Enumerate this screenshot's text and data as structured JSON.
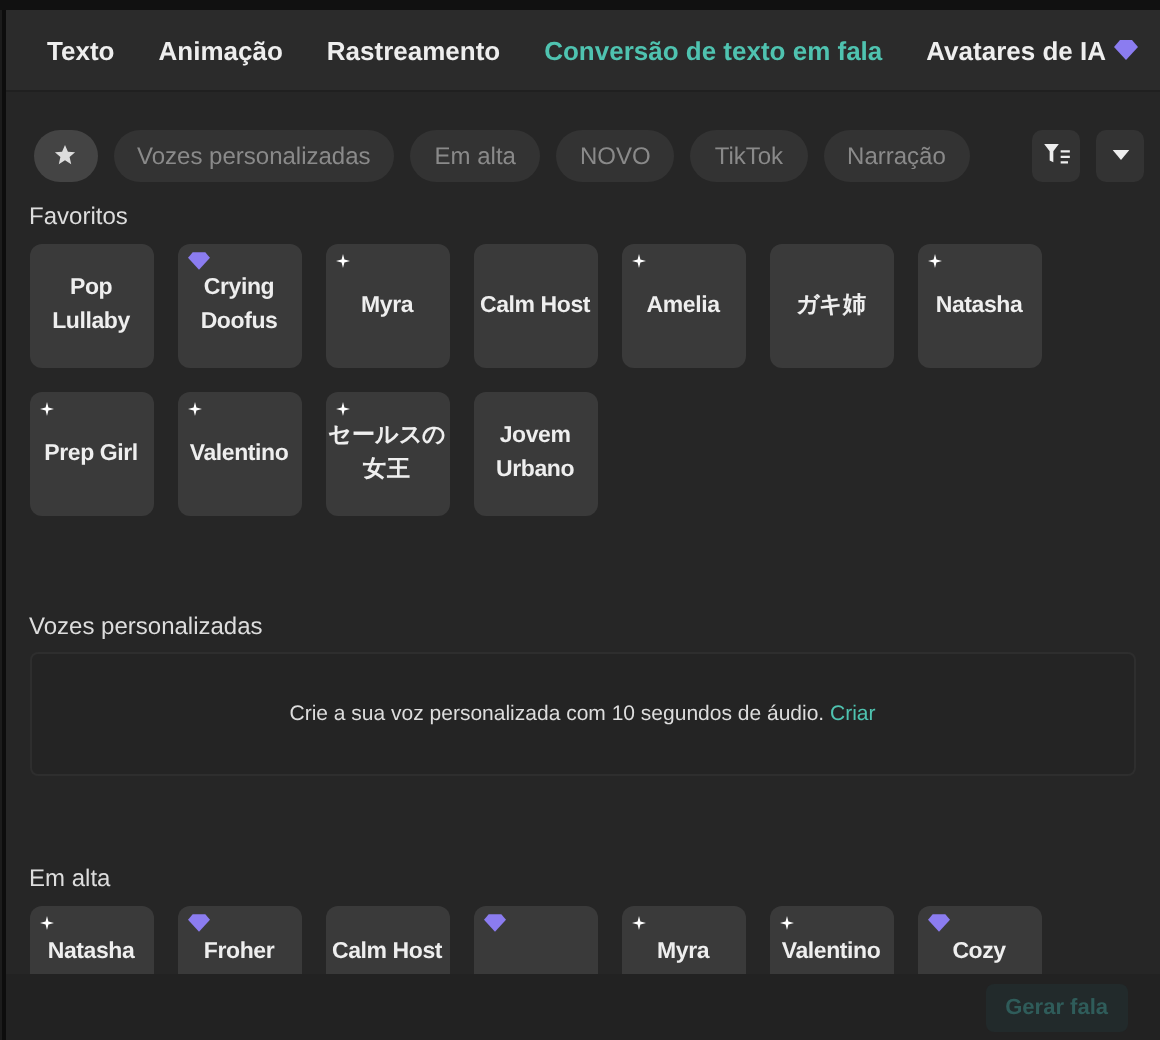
{
  "tabs": [
    {
      "label": "Texto",
      "selected": false,
      "premium": false
    },
    {
      "label": "Animação",
      "selected": false,
      "premium": false
    },
    {
      "label": "Rastreamento",
      "selected": false,
      "premium": false
    },
    {
      "label": "Conversão de texto em fala",
      "selected": true,
      "premium": false
    },
    {
      "label": "Avatares de IA",
      "selected": false,
      "premium": true
    }
  ],
  "filters": [
    {
      "kind": "star",
      "selected": true
    },
    {
      "kind": "text",
      "label": "Vozes personalizadas",
      "selected": false
    },
    {
      "kind": "text",
      "label": "Em alta",
      "selected": false
    },
    {
      "kind": "text",
      "label": "NOVO",
      "selected": false
    },
    {
      "kind": "text",
      "label": "TikTok",
      "selected": false
    },
    {
      "kind": "text",
      "label": "Narração",
      "selected": false
    }
  ],
  "favorites": {
    "title": "Favoritos",
    "voices": [
      {
        "name": "Pop Lullaby",
        "new": false,
        "premium": false
      },
      {
        "name": "Crying Doofus",
        "new": false,
        "premium": true
      },
      {
        "name": "Myra",
        "new": true,
        "premium": false
      },
      {
        "name": "Calm Host",
        "new": false,
        "premium": false
      },
      {
        "name": "Amelia",
        "new": true,
        "premium": false
      },
      {
        "name": "ガキ姉",
        "new": false,
        "premium": false
      },
      {
        "name": "Natasha",
        "new": true,
        "premium": false
      },
      {
        "name": "Prep Girl",
        "new": true,
        "premium": false
      },
      {
        "name": "Valentino",
        "new": true,
        "premium": false
      },
      {
        "name": "セールスの女王",
        "new": true,
        "premium": false
      },
      {
        "name": "Jovem Urbano",
        "new": false,
        "premium": false
      }
    ]
  },
  "custom": {
    "title": "Vozes personalizadas",
    "message": "Crie a sua voz personalizada com 10 segundos de áudio.",
    "link": "Criar"
  },
  "trending": {
    "title": "Em alta",
    "voices": [
      {
        "name": "Natasha",
        "new": true,
        "premium": false
      },
      {
        "name": "Froher",
        "new": false,
        "premium": true
      },
      {
        "name": "Calm Host",
        "new": false,
        "premium": false
      },
      {
        "new": false,
        "premium": true
      },
      {
        "name": "Myra",
        "new": true,
        "premium": false
      },
      {
        "name": "Valentino",
        "new": true,
        "premium": false
      },
      {
        "name": "Cozy",
        "new": false,
        "premium": true
      }
    ]
  },
  "action_button": {
    "label": "Gerar fala",
    "disabled": true
  }
}
